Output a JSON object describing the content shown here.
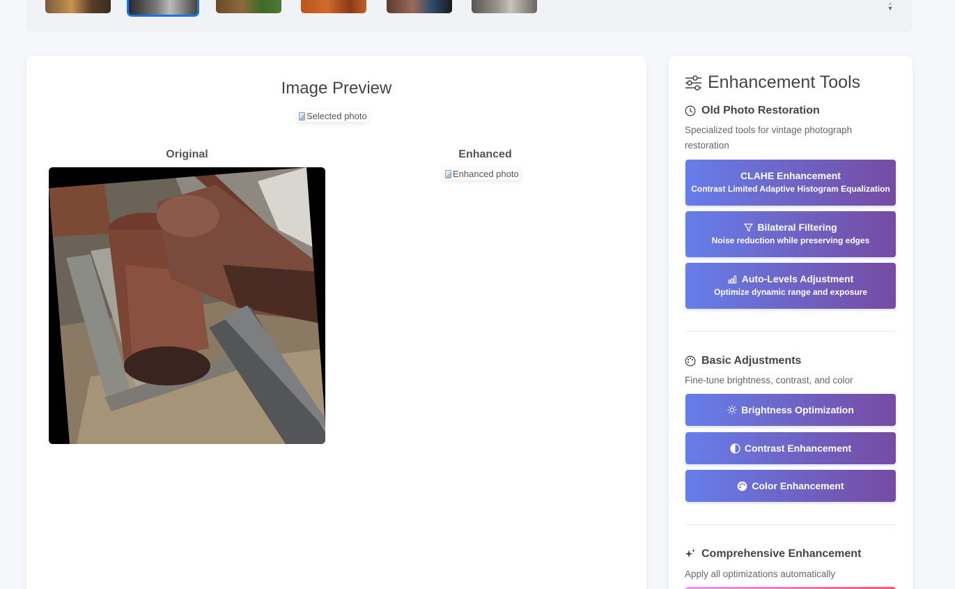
{
  "thumbnails": {
    "items": [
      "thumb-1",
      "thumb-2",
      "thumb-3",
      "thumb-4",
      "thumb-5",
      "thumb-6"
    ],
    "selected_index": 1
  },
  "preview": {
    "title": "Image Preview",
    "selected_alt": "Selected photo",
    "original_label": "Original",
    "enhanced_label": "Enhanced",
    "enhanced_alt": "Enhanced photo"
  },
  "tools": {
    "title": "Enhancement Tools",
    "sections": {
      "restoration": {
        "heading": "Old Photo Restoration",
        "description": "Specialized tools for vintage photograph restoration",
        "buttons": {
          "clahe": {
            "label": "CLAHE Enhancement",
            "sub": "Contrast Limited Adaptive Histogram Equalization"
          },
          "bilateral": {
            "label": "Bilateral Filtering",
            "sub": "Noise reduction while preserving edges"
          },
          "autolevels": {
            "label": "Auto-Levels Adjustment",
            "sub": "Optimize dynamic range and exposure"
          }
        }
      },
      "basic": {
        "heading": "Basic Adjustments",
        "description": "Fine-tune brightness, contrast, and color",
        "buttons": {
          "brightness": "Brightness Optimization",
          "contrast": "Contrast Enhancement",
          "color": "Color Enhancement"
        }
      },
      "comprehensive": {
        "heading": "Comprehensive Enhancement",
        "description": "Apply all optimizations automatically"
      }
    }
  },
  "colors": {
    "button_gradient_start": "#667eea",
    "button_gradient_end": "#764ba2",
    "selected_border": "#1a73e8",
    "comprehensive_gradient_start": "#f093fb",
    "comprehensive_gradient_end": "#f5576c"
  }
}
